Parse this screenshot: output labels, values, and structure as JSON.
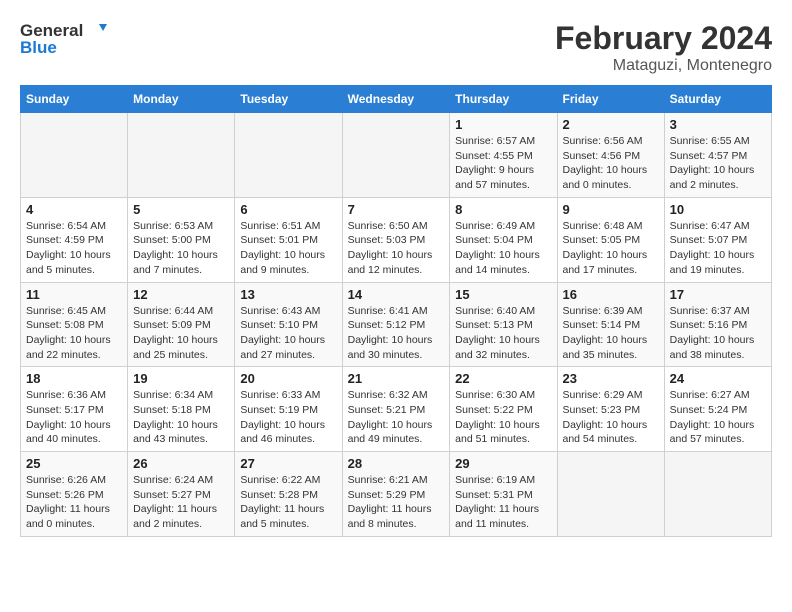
{
  "header": {
    "logo_line1": "General",
    "logo_line2": "Blue",
    "main_title": "February 2024",
    "sub_title": "Mataguzi, Montenegro"
  },
  "days_of_week": [
    "Sunday",
    "Monday",
    "Tuesday",
    "Wednesday",
    "Thursday",
    "Friday",
    "Saturday"
  ],
  "weeks": [
    [
      {
        "day": "",
        "info": ""
      },
      {
        "day": "",
        "info": ""
      },
      {
        "day": "",
        "info": ""
      },
      {
        "day": "",
        "info": ""
      },
      {
        "day": "1",
        "info": "Sunrise: 6:57 AM\nSunset: 4:55 PM\nDaylight: 9 hours and 57 minutes."
      },
      {
        "day": "2",
        "info": "Sunrise: 6:56 AM\nSunset: 4:56 PM\nDaylight: 10 hours and 0 minutes."
      },
      {
        "day": "3",
        "info": "Sunrise: 6:55 AM\nSunset: 4:57 PM\nDaylight: 10 hours and 2 minutes."
      }
    ],
    [
      {
        "day": "4",
        "info": "Sunrise: 6:54 AM\nSunset: 4:59 PM\nDaylight: 10 hours and 5 minutes."
      },
      {
        "day": "5",
        "info": "Sunrise: 6:53 AM\nSunset: 5:00 PM\nDaylight: 10 hours and 7 minutes."
      },
      {
        "day": "6",
        "info": "Sunrise: 6:51 AM\nSunset: 5:01 PM\nDaylight: 10 hours and 9 minutes."
      },
      {
        "day": "7",
        "info": "Sunrise: 6:50 AM\nSunset: 5:03 PM\nDaylight: 10 hours and 12 minutes."
      },
      {
        "day": "8",
        "info": "Sunrise: 6:49 AM\nSunset: 5:04 PM\nDaylight: 10 hours and 14 minutes."
      },
      {
        "day": "9",
        "info": "Sunrise: 6:48 AM\nSunset: 5:05 PM\nDaylight: 10 hours and 17 minutes."
      },
      {
        "day": "10",
        "info": "Sunrise: 6:47 AM\nSunset: 5:07 PM\nDaylight: 10 hours and 19 minutes."
      }
    ],
    [
      {
        "day": "11",
        "info": "Sunrise: 6:45 AM\nSunset: 5:08 PM\nDaylight: 10 hours and 22 minutes."
      },
      {
        "day": "12",
        "info": "Sunrise: 6:44 AM\nSunset: 5:09 PM\nDaylight: 10 hours and 25 minutes."
      },
      {
        "day": "13",
        "info": "Sunrise: 6:43 AM\nSunset: 5:10 PM\nDaylight: 10 hours and 27 minutes."
      },
      {
        "day": "14",
        "info": "Sunrise: 6:41 AM\nSunset: 5:12 PM\nDaylight: 10 hours and 30 minutes."
      },
      {
        "day": "15",
        "info": "Sunrise: 6:40 AM\nSunset: 5:13 PM\nDaylight: 10 hours and 32 minutes."
      },
      {
        "day": "16",
        "info": "Sunrise: 6:39 AM\nSunset: 5:14 PM\nDaylight: 10 hours and 35 minutes."
      },
      {
        "day": "17",
        "info": "Sunrise: 6:37 AM\nSunset: 5:16 PM\nDaylight: 10 hours and 38 minutes."
      }
    ],
    [
      {
        "day": "18",
        "info": "Sunrise: 6:36 AM\nSunset: 5:17 PM\nDaylight: 10 hours and 40 minutes."
      },
      {
        "day": "19",
        "info": "Sunrise: 6:34 AM\nSunset: 5:18 PM\nDaylight: 10 hours and 43 minutes."
      },
      {
        "day": "20",
        "info": "Sunrise: 6:33 AM\nSunset: 5:19 PM\nDaylight: 10 hours and 46 minutes."
      },
      {
        "day": "21",
        "info": "Sunrise: 6:32 AM\nSunset: 5:21 PM\nDaylight: 10 hours and 49 minutes."
      },
      {
        "day": "22",
        "info": "Sunrise: 6:30 AM\nSunset: 5:22 PM\nDaylight: 10 hours and 51 minutes."
      },
      {
        "day": "23",
        "info": "Sunrise: 6:29 AM\nSunset: 5:23 PM\nDaylight: 10 hours and 54 minutes."
      },
      {
        "day": "24",
        "info": "Sunrise: 6:27 AM\nSunset: 5:24 PM\nDaylight: 10 hours and 57 minutes."
      }
    ],
    [
      {
        "day": "25",
        "info": "Sunrise: 6:26 AM\nSunset: 5:26 PM\nDaylight: 11 hours and 0 minutes."
      },
      {
        "day": "26",
        "info": "Sunrise: 6:24 AM\nSunset: 5:27 PM\nDaylight: 11 hours and 2 minutes."
      },
      {
        "day": "27",
        "info": "Sunrise: 6:22 AM\nSunset: 5:28 PM\nDaylight: 11 hours and 5 minutes."
      },
      {
        "day": "28",
        "info": "Sunrise: 6:21 AM\nSunset: 5:29 PM\nDaylight: 11 hours and 8 minutes."
      },
      {
        "day": "29",
        "info": "Sunrise: 6:19 AM\nSunset: 5:31 PM\nDaylight: 11 hours and 11 minutes."
      },
      {
        "day": "",
        "info": ""
      },
      {
        "day": "",
        "info": ""
      }
    ]
  ]
}
